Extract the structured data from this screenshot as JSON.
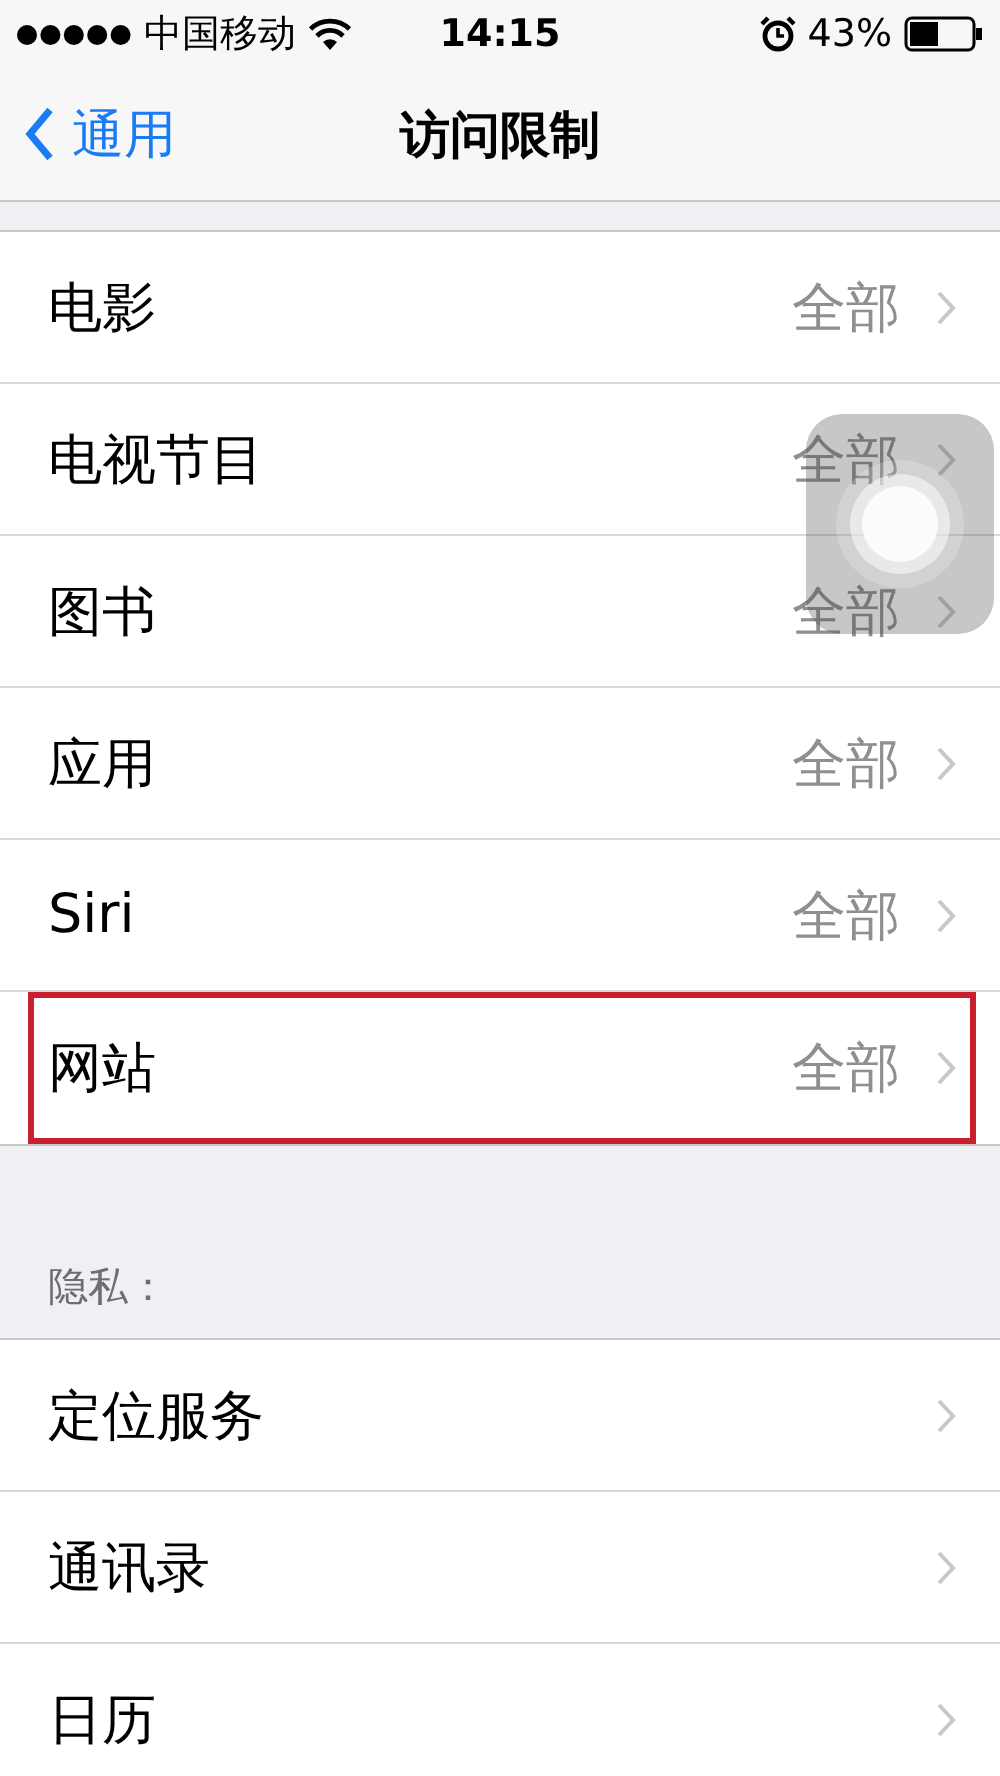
{
  "status_bar": {
    "carrier": "中国移动",
    "time": "14:15",
    "battery": "43%"
  },
  "nav": {
    "back": "通用",
    "title": "访问限制"
  },
  "sections": [
    {
      "rows": [
        {
          "label": "电影",
          "value": "全部",
          "highlighted": false
        },
        {
          "label": "电视节目",
          "value": "全部",
          "highlighted": false
        },
        {
          "label": "图书",
          "value": "全部",
          "highlighted": false
        },
        {
          "label": "应用",
          "value": "全部",
          "highlighted": false
        },
        {
          "label": "Siri",
          "value": "全部",
          "highlighted": false
        },
        {
          "label": "网站",
          "value": "全部",
          "highlighted": true
        }
      ]
    },
    {
      "header": "隐私：",
      "rows": [
        {
          "label": "定位服务",
          "highlighted": false
        },
        {
          "label": "通讯录",
          "highlighted": false
        },
        {
          "label": "日历",
          "highlighted": false
        }
      ]
    }
  ],
  "assistive_touch": {
    "kind": "floating-button"
  }
}
